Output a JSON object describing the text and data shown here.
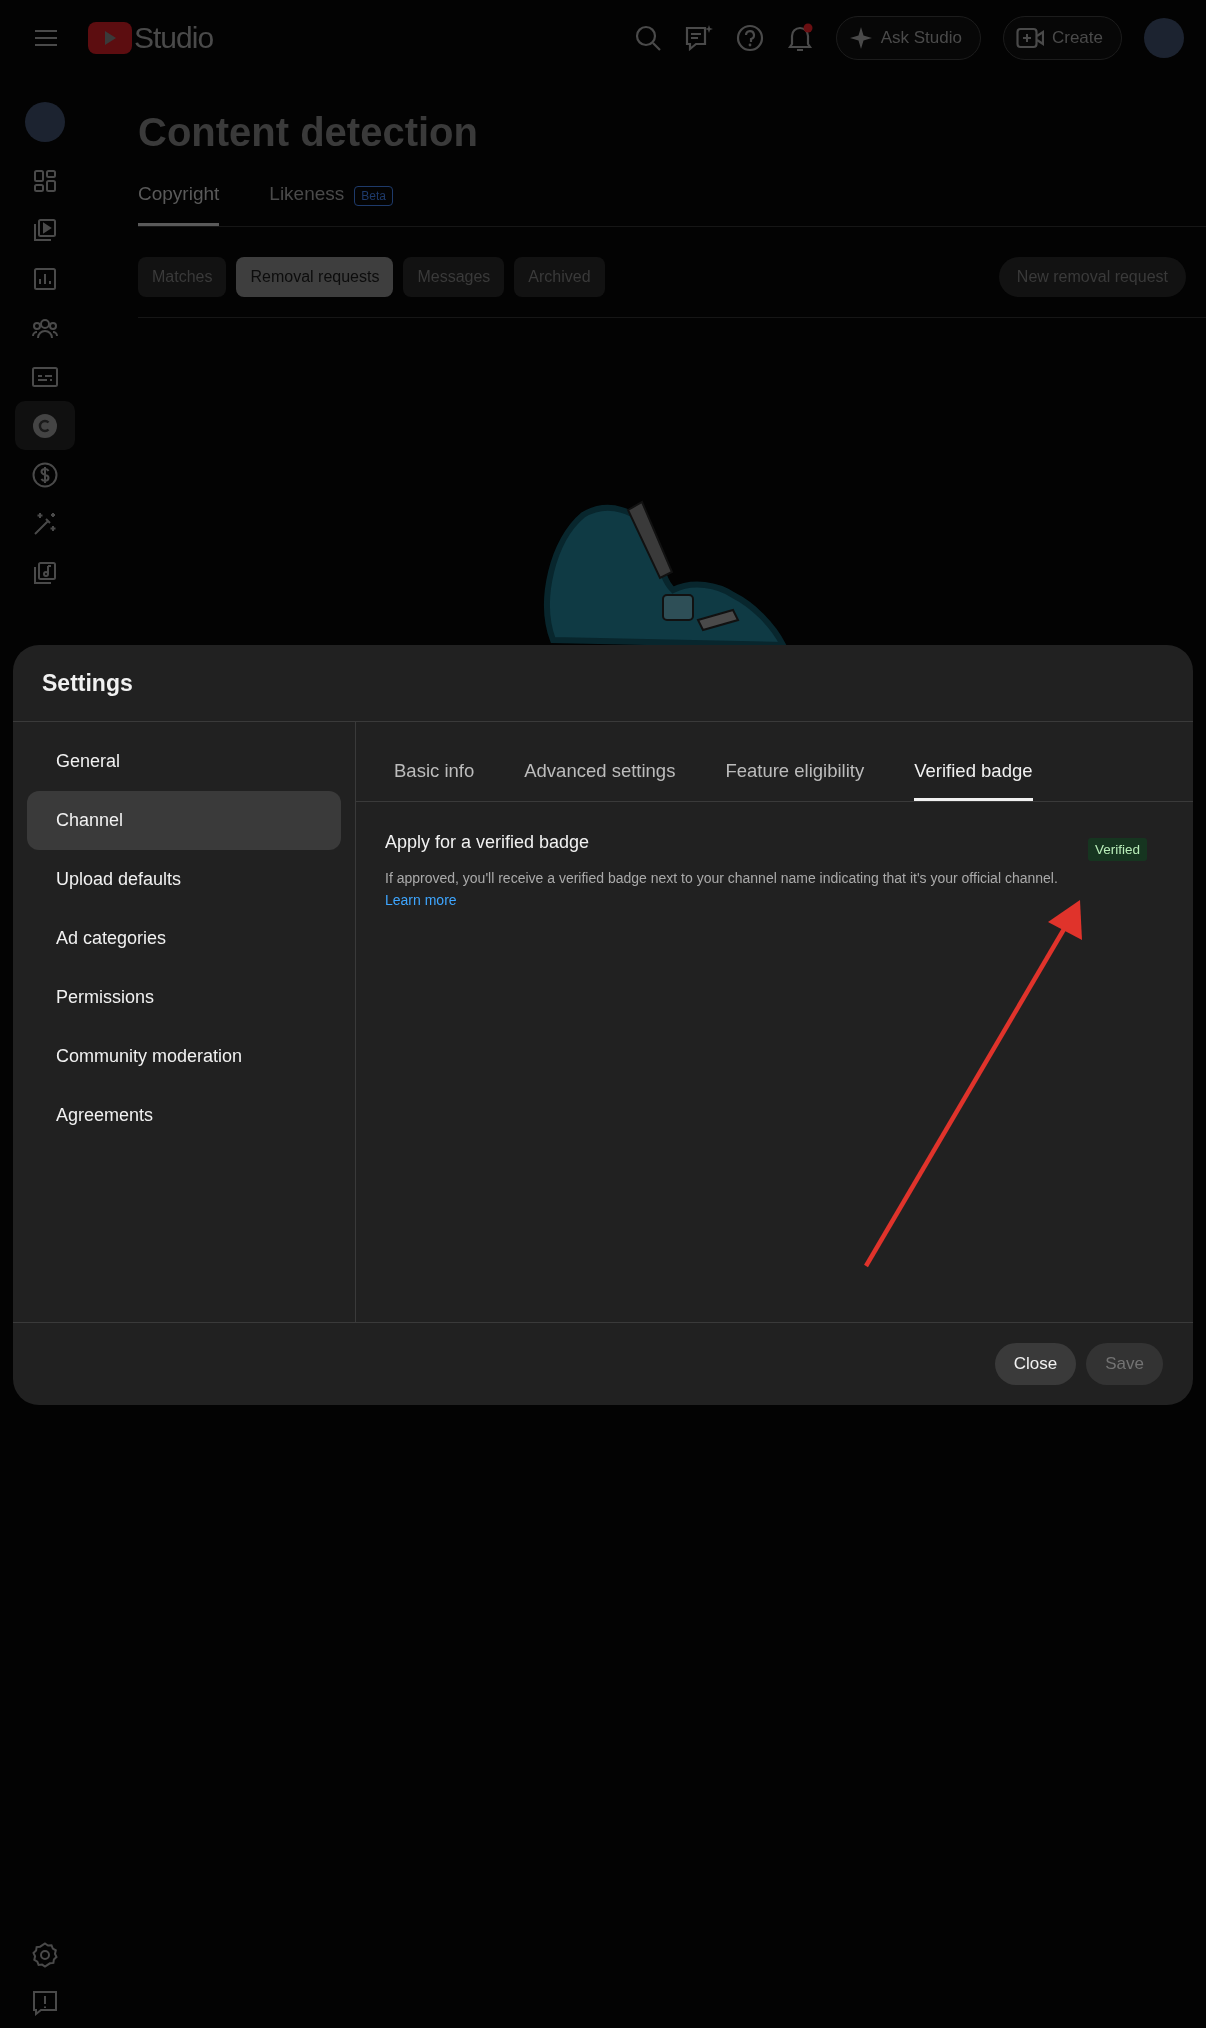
{
  "top_bar": {
    "logo_text": "Studio",
    "ask_button": "Ask Studio",
    "create_button": "Create"
  },
  "sidebar": {
    "items": [
      {
        "selected": false
      },
      {
        "selected": false
      },
      {
        "selected": false
      },
      {
        "selected": false
      },
      {
        "selected": false
      },
      {
        "selected": false
      },
      {
        "selected": true
      },
      {
        "selected": false
      },
      {
        "selected": false
      },
      {
        "selected": false
      }
    ]
  },
  "page": {
    "title": "Content detection",
    "tabs": [
      {
        "label": "Copyright",
        "selected": true
      },
      {
        "label": "Likeness",
        "selected": false,
        "badge": "Beta"
      }
    ],
    "chips": [
      {
        "label": "Matches",
        "selected": false
      },
      {
        "label": "Removal requests",
        "selected": true
      },
      {
        "label": "Messages",
        "selected": false
      },
      {
        "label": "Archived",
        "selected": false
      }
    ],
    "new_request_button": "New removal request"
  },
  "dialog": {
    "title": "Settings",
    "nav": [
      {
        "label": "General",
        "selected": false
      },
      {
        "label": "Channel",
        "selected": true
      },
      {
        "label": "Upload defaults",
        "selected": false
      },
      {
        "label": "Ad categories",
        "selected": false
      },
      {
        "label": "Permissions",
        "selected": false
      },
      {
        "label": "Community moderation",
        "selected": false
      },
      {
        "label": "Agreements",
        "selected": false
      }
    ],
    "tabs": [
      {
        "label": "Basic info",
        "selected": false
      },
      {
        "label": "Advanced settings",
        "selected": false
      },
      {
        "label": "Feature eligibility",
        "selected": false
      },
      {
        "label": "Verified badge",
        "selected": true
      }
    ],
    "section": {
      "heading": "Apply for a verified badge",
      "description": "If approved, you'll receive a verified badge next to your channel name indicating that it's your official channel.",
      "link": "Learn more",
      "status": "Verified"
    },
    "buttons": [
      {
        "label": "Close",
        "disabled": false
      },
      {
        "label": "Save",
        "disabled": true
      }
    ]
  }
}
